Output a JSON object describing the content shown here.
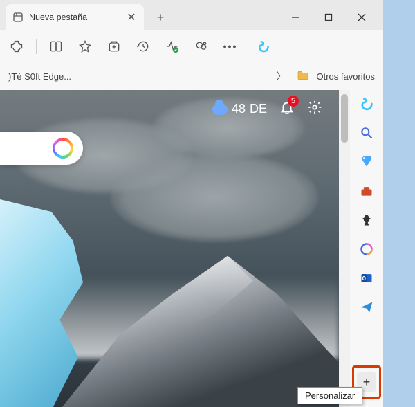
{
  "tab": {
    "title": "Nueva pestaña"
  },
  "favorites": {
    "item1_label": ")Té S0ft Edge...",
    "other_label": "Otros favoritos"
  },
  "ntp": {
    "temp_value": "48",
    "temp_unit": "DE",
    "notification_count": "5"
  },
  "sidebar": {
    "tooltip_customize": "Personalizar"
  },
  "icons": {
    "copilot": "copilot",
    "search": "search",
    "tag": "tag",
    "toolbox": "toolbox",
    "chess": "games",
    "m365": "m365",
    "outlook": "outlook",
    "telegram": "send"
  }
}
